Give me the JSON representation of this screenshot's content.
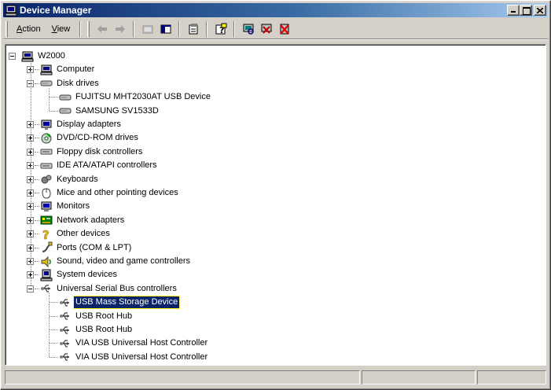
{
  "window": {
    "title": "Device Manager"
  },
  "menu": {
    "action_label": "Action",
    "view_label": "View"
  },
  "toolbar": {
    "icons": [
      "back-arrow-icon",
      "forward-arrow-icon",
      "up-folder-icon",
      "show-hide-tree-icon",
      "properties-icon",
      "help-icon",
      "scan-hardware-icon",
      "uninstall-icon",
      "disable-icon"
    ]
  },
  "tree": {
    "root": "W2000",
    "categories": [
      {
        "label": "Computer",
        "expanded": false
      },
      {
        "label": "Disk drives",
        "expanded": true,
        "children": [
          "FUJITSU MHT2030AT USB Device",
          "SAMSUNG SV1533D"
        ]
      },
      {
        "label": "Display adapters",
        "expanded": false
      },
      {
        "label": "DVD/CD-ROM drives",
        "expanded": false
      },
      {
        "label": "Floppy disk controllers",
        "expanded": false
      },
      {
        "label": "IDE ATA/ATAPI controllers",
        "expanded": false
      },
      {
        "label": "Keyboards",
        "expanded": false
      },
      {
        "label": "Mice and other pointing devices",
        "expanded": false
      },
      {
        "label": "Monitors",
        "expanded": false
      },
      {
        "label": "Network adapters",
        "expanded": false
      },
      {
        "label": "Other devices",
        "expanded": false
      },
      {
        "label": "Ports (COM & LPT)",
        "expanded": false
      },
      {
        "label": "Sound, video and game controllers",
        "expanded": false
      },
      {
        "label": "System devices",
        "expanded": false
      },
      {
        "label": "Universal Serial Bus controllers",
        "expanded": true,
        "children": [
          "USB Mass Storage Device",
          "USB Root Hub",
          "USB Root Hub",
          "VIA USB Universal Host Controller",
          "VIA USB Universal Host Controller"
        ]
      }
    ],
    "selected": "USB Mass Storage Device"
  },
  "colors": {
    "titlebar_start": "#0a246a",
    "titlebar_end": "#a6caf0",
    "selection": "#0a246a",
    "face": "#d4d0c8"
  }
}
